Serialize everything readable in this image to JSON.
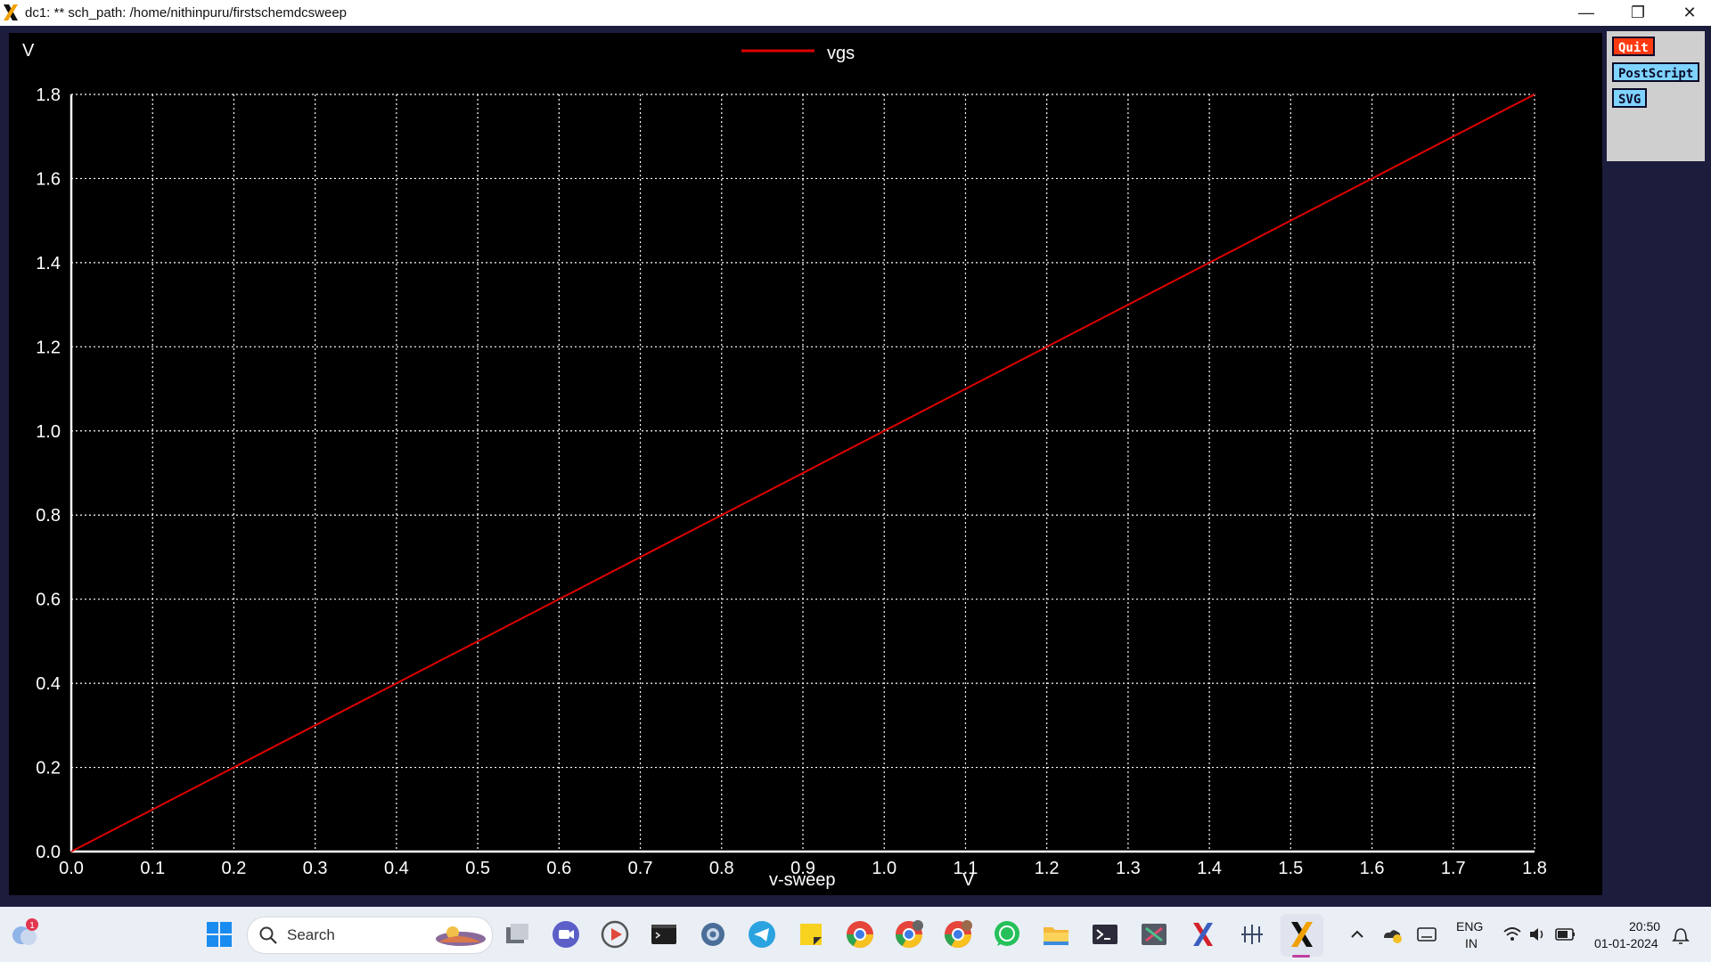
{
  "window": {
    "title": "dc1: ** sch_path: /home/nithinpuru/firstschemdcsweep",
    "controls": {
      "minimize": "—",
      "restore": "❐",
      "close": "✕"
    }
  },
  "side_panel": {
    "buttons": [
      {
        "label": "Quit",
        "color": "#ff3a10"
      },
      {
        "label": "PostScript",
        "color": "#7fd3ff"
      },
      {
        "label": "SVG",
        "color": "#7fd3ff"
      }
    ]
  },
  "chart_data": {
    "type": "line",
    "ylabel": "V",
    "xlabel": "v-sweep",
    "xunit": "V",
    "xlim": [
      0,
      1.8
    ],
    "ylim": [
      0,
      1.8
    ],
    "grid": true,
    "legend_position": "top",
    "x_ticks": [
      "0.0",
      "0.1",
      "0.2",
      "0.3",
      "0.4",
      "0.5",
      "0.6",
      "0.7",
      "0.8",
      "0.9",
      "1.0",
      "1.1",
      "1.2",
      "1.3",
      "1.4",
      "1.5",
      "1.6",
      "1.7",
      "1.8"
    ],
    "y_ticks": [
      "0.0",
      "0.2",
      "0.4",
      "0.6",
      "0.8",
      "1.0",
      "1.2",
      "1.4",
      "1.6",
      "1.8"
    ],
    "series": [
      {
        "name": "vgs",
        "color": "#e00000",
        "points": [
          [
            0,
            0
          ],
          [
            0.2,
            0.2
          ],
          [
            0.4,
            0.4
          ],
          [
            0.6,
            0.6
          ],
          [
            0.8,
            0.8
          ],
          [
            1.0,
            1.0
          ],
          [
            1.2,
            1.2
          ],
          [
            1.4,
            1.4
          ],
          [
            1.6,
            1.6
          ],
          [
            1.8,
            1.8
          ]
        ]
      }
    ]
  },
  "taskbar": {
    "search_placeholder": "Search",
    "weather_badge": "1",
    "lang_top": "ENG",
    "lang_bottom": "IN",
    "time": "20:50",
    "date": "01-01-2024",
    "apps": [
      "windows-start-icon",
      "task-view-icon",
      "meet-icon",
      "media-player-icon",
      "terminal-icon",
      "settings-icon",
      "telegram-icon",
      "sticky-notes-icon",
      "chrome-icon",
      "chrome-profile-icon",
      "chrome-profile2-icon",
      "whatsapp-icon",
      "file-explorer-icon",
      "powershell-icon",
      "snipping-tool-icon",
      "xschem-icon",
      "xserver-icon",
      "xschem-active-icon"
    ]
  }
}
